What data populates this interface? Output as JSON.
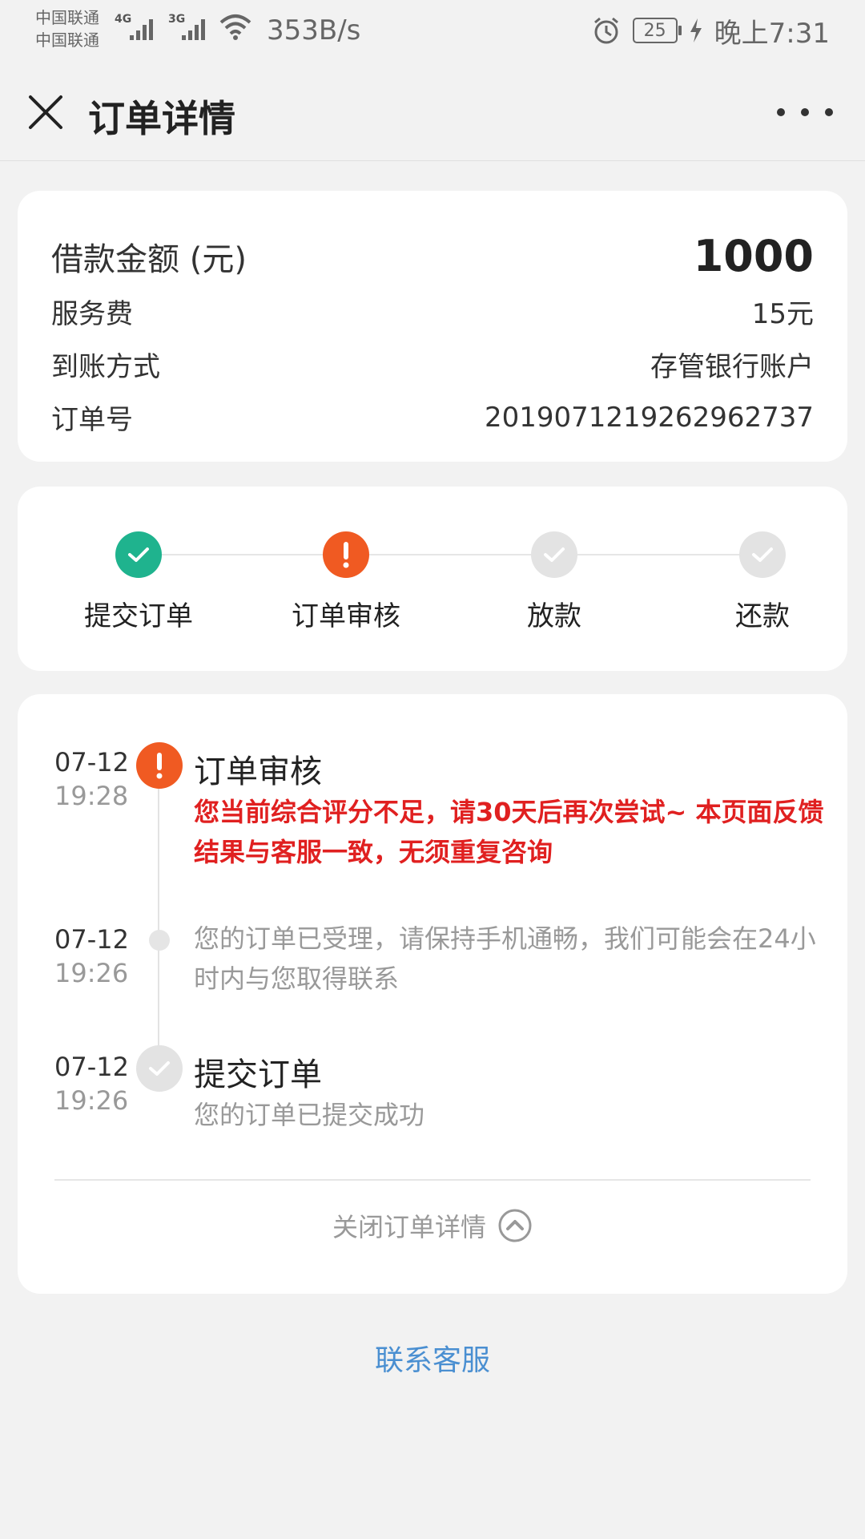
{
  "status_bar": {
    "carrier_1": "中国联通",
    "carrier_2": "中国联通",
    "net_1": "4G",
    "net_2": "3G",
    "speed": "353B/s",
    "battery": "25",
    "time": "晚上7:31"
  },
  "nav": {
    "title": "订单详情"
  },
  "info": {
    "amount_label": "借款金额 (元)",
    "amount_value": "1000",
    "fee_label": "服务费",
    "fee_value": "15元",
    "method_label": "到账方式",
    "method_value": "存管银行账户",
    "order_label": "订单号",
    "order_value": "2019071219262962737"
  },
  "steps": [
    {
      "label": "提交订单",
      "status": "done"
    },
    {
      "label": "订单审核",
      "status": "error"
    },
    {
      "label": "放款",
      "status": "pending"
    },
    {
      "label": "还款",
      "status": "pending"
    }
  ],
  "timeline": [
    {
      "date": "07-12",
      "time": "19:28",
      "title": "订单审核",
      "desc": "您当前综合评分不足，请30天后再次尝试~ 本页面反馈结果与客服一致，无须重复咨询"
    },
    {
      "date": "07-12",
      "time": "19:26",
      "desc": "您的订单已受理，请保持手机通畅，我们可能会在24小时内与您取得联系"
    },
    {
      "date": "07-12",
      "time": "19:26",
      "title": "提交订单",
      "desc": "您的订单已提交成功"
    }
  ],
  "collapse_label": "关闭订单详情",
  "contact_label": "联系客服",
  "colors": {
    "success": "#1fb38e",
    "error": "#f05a22",
    "pending": "#e3e3e3",
    "link": "#4a8fd1",
    "warning_text": "#e02020"
  }
}
